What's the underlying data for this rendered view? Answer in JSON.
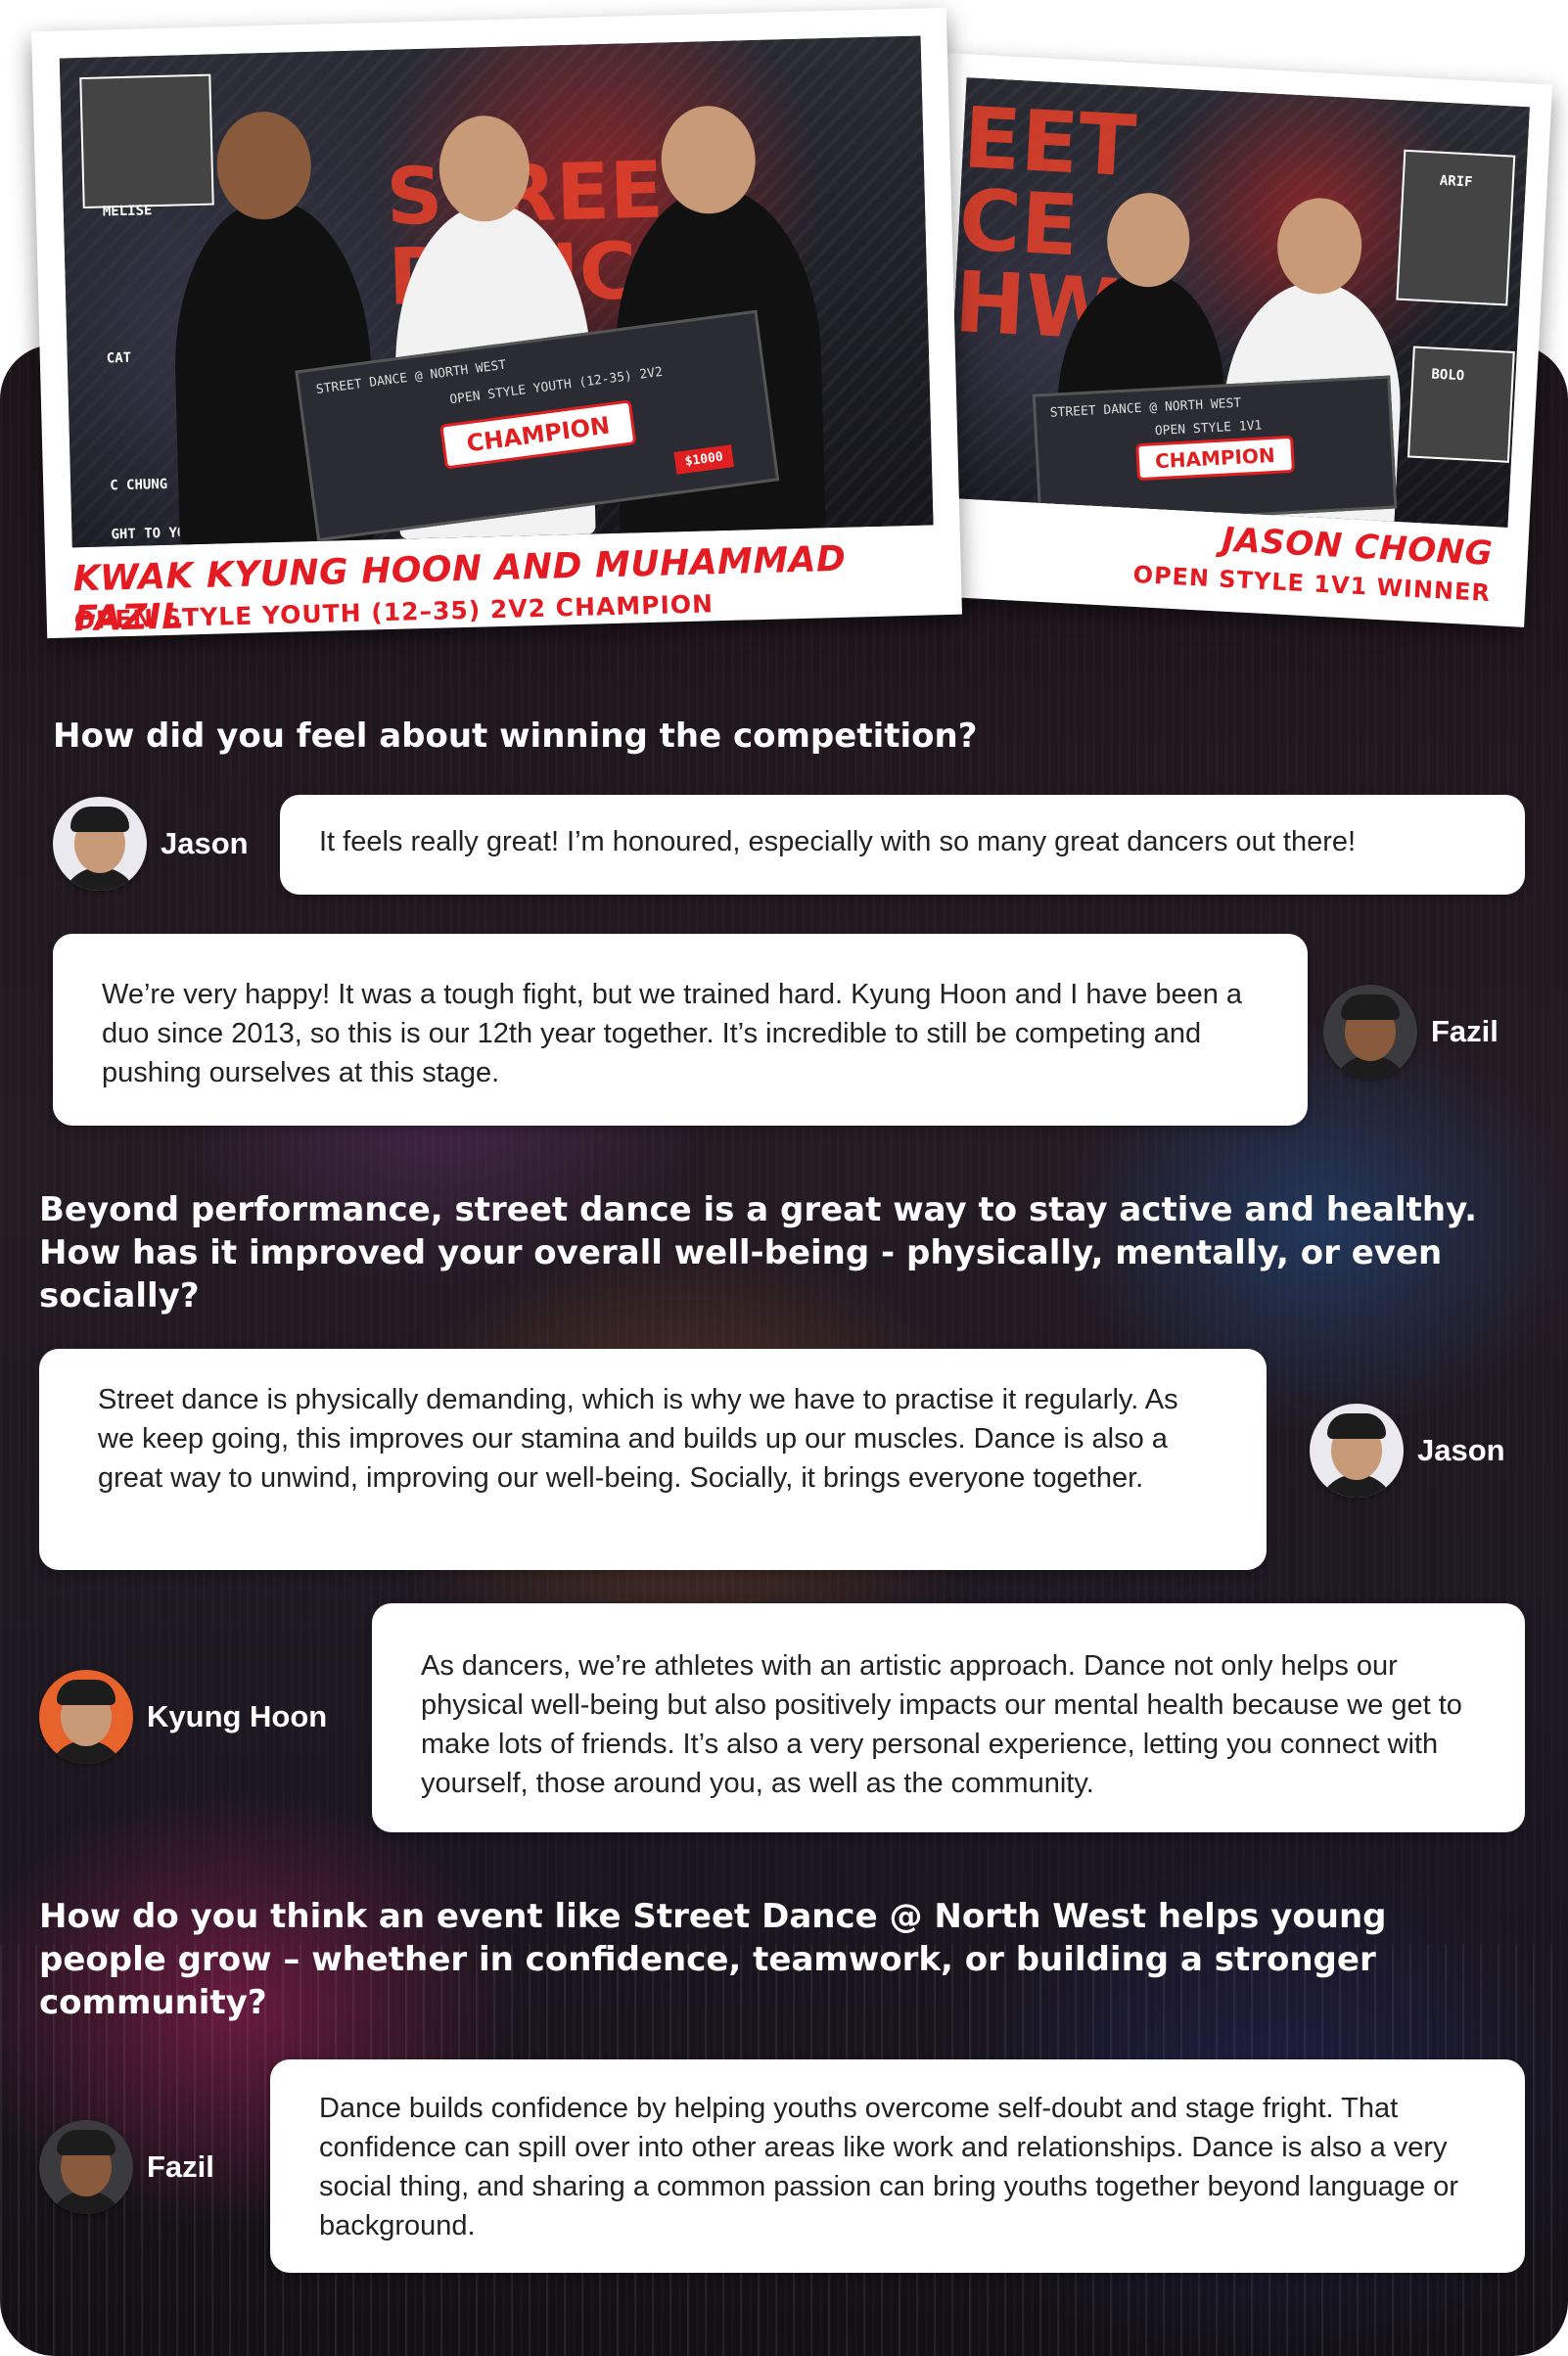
{
  "photos": [
    {
      "title": "KWAK KYUNG HOON AND MUHAMMAD FAZIL",
      "subtitle": "OPEN STYLE YOUTH (12–35) 2V2 CHAMPION",
      "check_label": "CHAMPION",
      "check_category": "OPEN STYLE YOUTH (12-35) 2V2",
      "check_brand": "STREET DANCE @ NORTH WEST",
      "check_amount": "$1000",
      "side_names": [
        "MELISE",
        "CAT",
        "C CHUNG",
        "GHT TO YOU B"
      ]
    },
    {
      "title": "JASON CHONG",
      "subtitle": "OPEN STYLE 1V1 WINNER",
      "check_label": "CHAMPION",
      "check_category": "OPEN STYLE 1V1",
      "check_brand": "STREET DANCE @ NORTH WEST",
      "side_names": [
        "ARIF",
        "BOLO"
      ]
    }
  ],
  "sections": [
    {
      "question": "How did you feel about winning the competition?",
      "answers": [
        {
          "speaker": "Jason",
          "text": "It feels really great! I’m honoured, especially with so many great dancers out there!"
        },
        {
          "speaker": "Fazil",
          "text": "We’re very happy! It was a tough fight, but we trained hard. Kyung Hoon and I have been a duo since 2013, so this is our 12th year together. It’s incredible to still be competing and pushing ourselves at this stage."
        }
      ]
    },
    {
      "question": "Beyond performance, street dance is a great way to stay active and healthy. How has it improved your overall well-being - physically, mentally, or even socially?",
      "answers": [
        {
          "speaker": "Jason",
          "text": "Street dance is physically demanding, which is why we have to practise it regularly. As we keep going, this improves our stamina and builds up our muscles. Dance is also a great way to unwind, improving our well-being. Socially, it brings everyone together."
        },
        {
          "speaker": "Kyung Hoon",
          "text": "As dancers, we’re athletes with an artistic approach. Dance not only helps our physical well-being but also positively impacts our mental health because we get to make lots of friends. It’s also a very personal experience, letting you connect with yourself, those around you, as well as the community."
        }
      ]
    },
    {
      "question": "How do you think an event like Street Dance @ North West helps young people grow – whether in confidence, teamwork, or building a stronger community?",
      "answers": [
        {
          "speaker": "Fazil",
          "text": "Dance builds confidence by helping youths overcome self-doubt and stage fright. That confidence can spill over into other areas like work and relationships. Dance is also a very social thing, and sharing a common passion can bring youths together beyond language or background."
        }
      ]
    }
  ]
}
